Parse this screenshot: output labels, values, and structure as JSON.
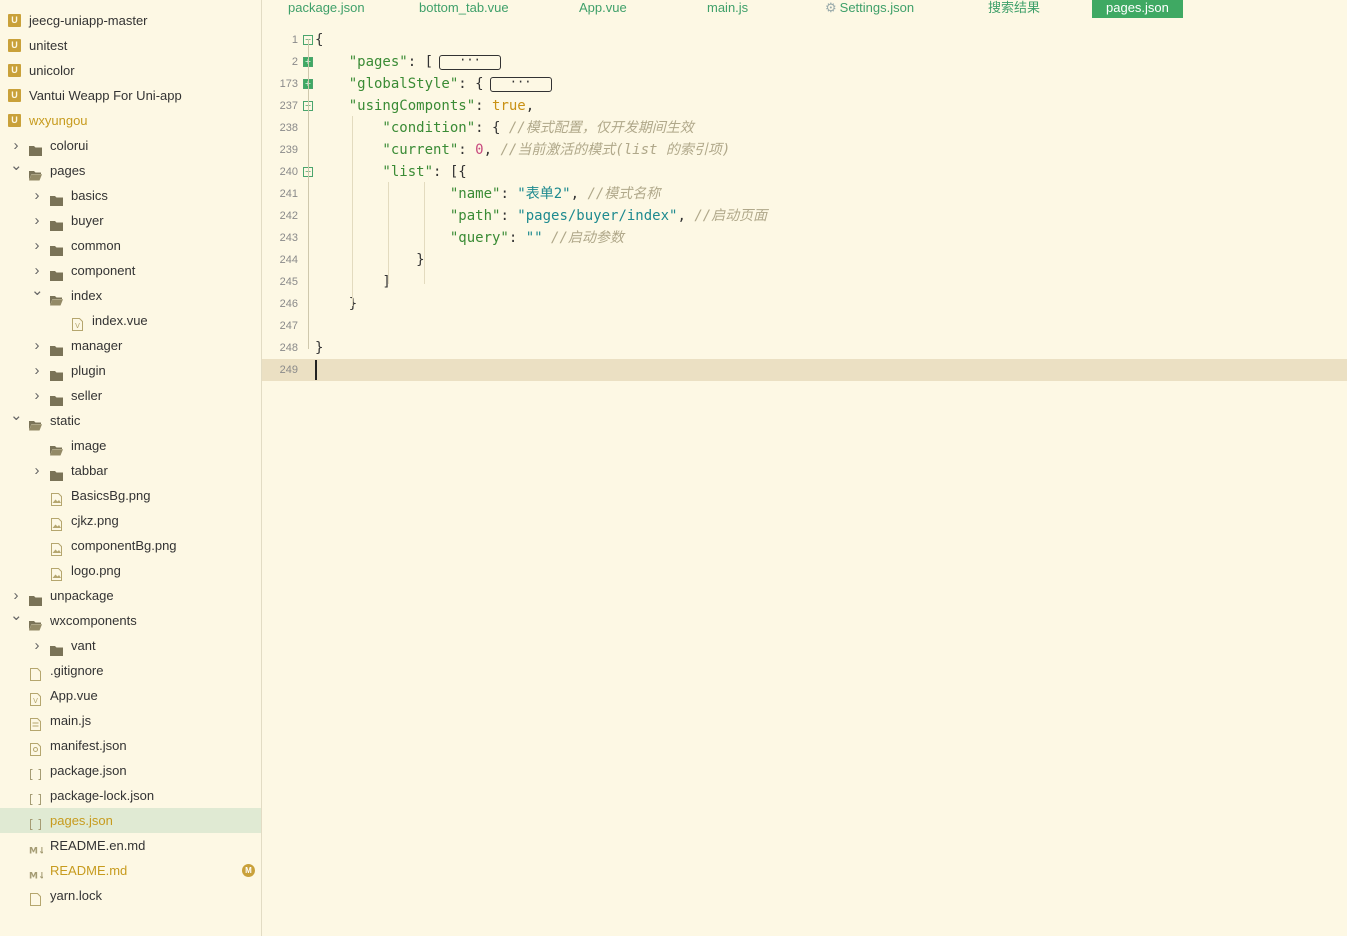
{
  "sidebar": {
    "items": [
      {
        "label": "jeecg-uniapp-master",
        "kind": "project",
        "depth": 0
      },
      {
        "label": "unitest",
        "kind": "project",
        "depth": 0
      },
      {
        "label": "unicolor",
        "kind": "project",
        "depth": 0
      },
      {
        "label": "Vantui Weapp For Uni-app",
        "kind": "project",
        "depth": 0
      },
      {
        "label": "wxyungou",
        "kind": "project",
        "depth": 0,
        "highlight": true
      },
      {
        "label": "colorui",
        "kind": "folder",
        "depth": 1,
        "chevron": "right"
      },
      {
        "label": "pages",
        "kind": "folder-open",
        "depth": 1,
        "chevron": "down"
      },
      {
        "label": "basics",
        "kind": "folder",
        "depth": 2,
        "chevron": "right"
      },
      {
        "label": "buyer",
        "kind": "folder",
        "depth": 2,
        "chevron": "right"
      },
      {
        "label": "common",
        "kind": "folder",
        "depth": 2,
        "chevron": "right"
      },
      {
        "label": "component",
        "kind": "folder",
        "depth": 2,
        "chevron": "right"
      },
      {
        "label": "index",
        "kind": "folder-open",
        "depth": 2,
        "chevron": "down"
      },
      {
        "label": "index.vue",
        "kind": "vue",
        "depth": 3
      },
      {
        "label": "manager",
        "kind": "folder",
        "depth": 2,
        "chevron": "right"
      },
      {
        "label": "plugin",
        "kind": "folder",
        "depth": 2,
        "chevron": "right"
      },
      {
        "label": "seller",
        "kind": "folder",
        "depth": 2,
        "chevron": "right"
      },
      {
        "label": "static",
        "kind": "folder-open",
        "depth": 1,
        "chevron": "down"
      },
      {
        "label": "image",
        "kind": "folder-open",
        "depth": 2
      },
      {
        "label": "tabbar",
        "kind": "folder",
        "depth": 2,
        "chevron": "right"
      },
      {
        "label": "BasicsBg.png",
        "kind": "image",
        "depth": 2
      },
      {
        "label": "cjkz.png",
        "kind": "image",
        "depth": 2
      },
      {
        "label": "componentBg.png",
        "kind": "image",
        "depth": 2
      },
      {
        "label": "logo.png",
        "kind": "image",
        "depth": 2
      },
      {
        "label": "unpackage",
        "kind": "folder",
        "depth": 1,
        "chevron": "right"
      },
      {
        "label": "wxcomponents",
        "kind": "folder-open",
        "depth": 1,
        "chevron": "down"
      },
      {
        "label": "vant",
        "kind": "folder",
        "depth": 2,
        "chevron": "right"
      },
      {
        "label": ".gitignore",
        "kind": "file",
        "depth": 1
      },
      {
        "label": "App.vue",
        "kind": "vue",
        "depth": 1
      },
      {
        "label": "main.js",
        "kind": "js",
        "depth": 1
      },
      {
        "label": "manifest.json",
        "kind": "manifest",
        "depth": 1
      },
      {
        "label": "package.json",
        "kind": "json",
        "depth": 1
      },
      {
        "label": "package-lock.json",
        "kind": "json",
        "depth": 1
      },
      {
        "label": "pages.json",
        "kind": "json",
        "depth": 1,
        "active": true
      },
      {
        "label": "README.en.md",
        "kind": "md",
        "depth": 1
      },
      {
        "label": "README.md",
        "kind": "md",
        "depth": 1,
        "highlight": true,
        "badge": "M"
      },
      {
        "label": "yarn.lock",
        "kind": "file",
        "depth": 1
      }
    ]
  },
  "tabs": [
    {
      "label": "package.json"
    },
    {
      "label": "bottom_tab.vue"
    },
    {
      "label": "App.vue"
    },
    {
      "label": "main.js"
    },
    {
      "label": "Settings.json",
      "icon": "gear-icon"
    },
    {
      "label": "搜索结果"
    },
    {
      "label": "pages.json",
      "active": true
    }
  ],
  "editor": {
    "lines": [
      {
        "no": "1",
        "fold": "minus",
        "parts": [
          {
            "t": "{",
            "c": "p"
          }
        ]
      },
      {
        "no": "2",
        "fold": "plus",
        "parts": [
          {
            "t": "    \"pages\"",
            "c": "k"
          },
          {
            "t": ": [",
            "c": "p"
          }
        ],
        "collapsed": "···"
      },
      {
        "no": "173",
        "fold": "plus",
        "parts": [
          {
            "t": "    \"globalStyle\"",
            "c": "k"
          },
          {
            "t": ": {",
            "c": "p"
          }
        ],
        "collapsed": "···"
      },
      {
        "no": "237",
        "fold": "minus",
        "parts": [
          {
            "t": "    \"usingComponts\"",
            "c": "k"
          },
          {
            "t": ": ",
            "c": "p"
          },
          {
            "t": "true",
            "c": "kw"
          },
          {
            "t": ",",
            "c": "p"
          }
        ]
      },
      {
        "no": "238",
        "parts": [
          {
            "t": "        \"condition\"",
            "c": "k"
          },
          {
            "t": ": { ",
            "c": "p"
          },
          {
            "t": "//模式配置，仅开发期间生效",
            "c": "c"
          }
        ]
      },
      {
        "no": "239",
        "parts": [
          {
            "t": "        \"current\"",
            "c": "k"
          },
          {
            "t": ": ",
            "c": "p"
          },
          {
            "t": "0",
            "c": "num"
          },
          {
            "t": ", ",
            "c": "p"
          },
          {
            "t": "//当前激活的模式(list 的索引项)",
            "c": "c"
          }
        ]
      },
      {
        "no": "240",
        "fold": "minus",
        "parts": [
          {
            "t": "        \"list\"",
            "c": "k"
          },
          {
            "t": ": [{",
            "c": "p"
          }
        ]
      },
      {
        "no": "241",
        "parts": [
          {
            "t": "                \"name\"",
            "c": "k"
          },
          {
            "t": ": ",
            "c": "p"
          },
          {
            "t": "\"表单2\"",
            "c": "s"
          },
          {
            "t": ", ",
            "c": "p"
          },
          {
            "t": "//模式名称",
            "c": "c"
          }
        ]
      },
      {
        "no": "242",
        "parts": [
          {
            "t": "                \"path\"",
            "c": "k"
          },
          {
            "t": ": ",
            "c": "p"
          },
          {
            "t": "\"pages/buyer/index\"",
            "c": "s"
          },
          {
            "t": ", ",
            "c": "p"
          },
          {
            "t": "//启动页面",
            "c": "c"
          }
        ]
      },
      {
        "no": "243",
        "parts": [
          {
            "t": "                \"query\"",
            "c": "k"
          },
          {
            "t": ": ",
            "c": "p"
          },
          {
            "t": "\"\"",
            "c": "s"
          },
          {
            "t": " ",
            "c": "p"
          },
          {
            "t": "//启动参数",
            "c": "c"
          }
        ]
      },
      {
        "no": "244",
        "parts": [
          {
            "t": "            }",
            "c": "p"
          }
        ]
      },
      {
        "no": "245",
        "parts": [
          {
            "t": "        ]",
            "c": "p"
          }
        ]
      },
      {
        "no": "246",
        "parts": [
          {
            "t": "    }",
            "c": "p"
          }
        ]
      },
      {
        "no": "247",
        "parts": []
      },
      {
        "no": "248",
        "parts": [
          {
            "t": "}",
            "c": "p"
          }
        ]
      },
      {
        "no": "249",
        "parts": [],
        "current": true
      }
    ]
  }
}
